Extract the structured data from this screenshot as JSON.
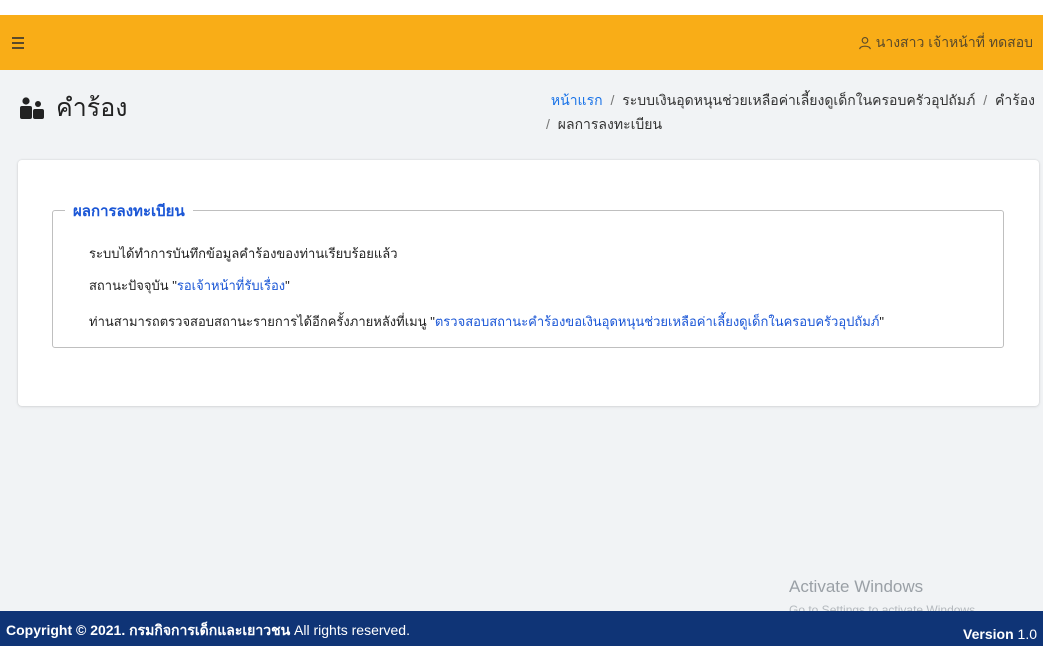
{
  "navbar": {
    "menu_icon": "hamburger-icon",
    "user_icon": "user-icon",
    "user_name": "นางสาว เจ้าหน้าที่ ทดสอบ",
    "bg_color": "#f9ad17"
  },
  "page": {
    "title": "คำร้อง",
    "title_icon": "users-icon"
  },
  "breadcrumb": {
    "home": "หน้าแรก",
    "section": "ระบบเงินอุดหนุนช่วยเหลือค่าเลี้ยงดูเด็กในครอบครัวอุปถัมภ์",
    "request": "คำร้อง",
    "current": "ผลการลงทะเบียน",
    "separator": "/"
  },
  "result": {
    "legend": "ผลการลงทะเบียน",
    "line1": "ระบบได้ทำการบันทึกข้อมูลคำร้องของท่านเรียบร้อยแล้ว",
    "line2_prefix": "สถานะปัจจุบัน",
    "status": "รอเจ้าหน้าที่รับเรื่อง",
    "line3_prefix": "ท่านสามารถตรวจสอบสถานะรายการได้อีกครั้งภายหลังที่เมนู",
    "menu_name": "ตรวจสอบสถานะคำร้องขอเงินอุดหนุนช่วยเหลือค่าเลี้ยงดูเด็กในครอบครัวอุปถัมภ์",
    "accent_color": "#1a56d6"
  },
  "watermark": {
    "title": "Activate Windows",
    "subtitle": "Go to Settings to activate Windows."
  },
  "footer": {
    "copyright_prefix": "Copyright © 2021.",
    "org": "กรมกิจการเด็กและเยาวชน",
    "rights": "All rights reserved.",
    "version_label": "Version",
    "version_value": "1.0",
    "bg_color": "#0f3476"
  }
}
